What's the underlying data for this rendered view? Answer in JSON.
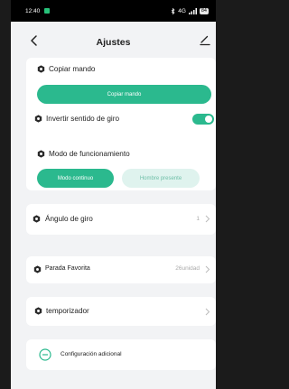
{
  "status_bar": {
    "time": "12:40",
    "signal": "4G",
    "battery": "84"
  },
  "header": {
    "title": "Ajustes"
  },
  "copiar_mando": {
    "label": "Copiar mando",
    "button": "Copiar mando"
  },
  "invertir": {
    "label": "Invertir sentido de giro",
    "enabled": true
  },
  "modo": {
    "label": "Modo de funcionamiento",
    "options": [
      "Modo continuo",
      "Hombre presente"
    ],
    "selected": "Modo continuo"
  },
  "angulo": {
    "label": "Ángulo de giro",
    "value": "1"
  },
  "parada": {
    "label": "Parada Favorita",
    "value": "26unidad"
  },
  "temporizador": {
    "label": "temporizador"
  },
  "config": {
    "label": "Configuración adicional"
  },
  "colors": {
    "accent": "#2bb98e",
    "accent_light": "#dff3ee",
    "background": "#f2f3f5"
  }
}
